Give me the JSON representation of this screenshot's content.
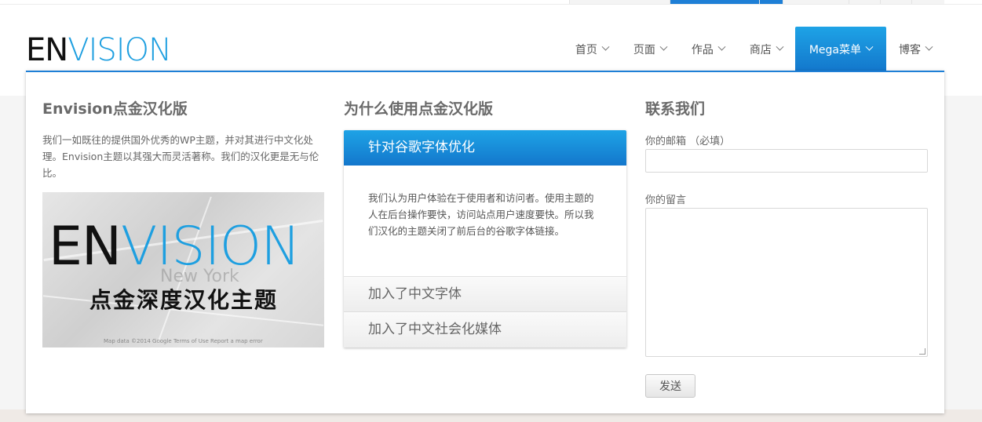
{
  "logo": {
    "part1": "EN",
    "part2": "VISION"
  },
  "nav": {
    "items": [
      {
        "label": "首页"
      },
      {
        "label": "页面"
      },
      {
        "label": "作品"
      },
      {
        "label": "商店"
      },
      {
        "label": "Mega菜单"
      },
      {
        "label": "博客"
      }
    ],
    "active_index": 4
  },
  "mega": {
    "col1": {
      "title": "Envision点金汉化版",
      "text": "我们一如既往的提供国外优秀的WP主题，并对其进行中文化处理。Envision主题以其强大而灵活著称。我们的汉化更是无与伦比。",
      "banner": {
        "part1": "EN",
        "part2": "VISION",
        "subtitle": "点金深度汉化主题",
        "map_label": "New York",
        "credits": "Map data ©2014 Google   Terms of Use   Report a map error"
      }
    },
    "col2": {
      "title": "为什么使用点金汉化版",
      "active_tab": "针对谷歌字体优化",
      "active_body": "我们认为用户体验在于使用者和访问者。使用主题的人在后台操作要快，访问站点用户速度要快。所以我们汉化的主题关闭了前后台的谷歌字体链接。",
      "tabs": [
        "加入了中文字体",
        "加入了中文社会化媒体"
      ]
    },
    "col3": {
      "title": "联系我们",
      "email_label": "你的邮箱 （必填）",
      "email_value": "",
      "message_label": "你的留言",
      "message_value": "",
      "submit_label": "发送"
    }
  },
  "colors": {
    "accent": "#1e7fd6",
    "accent_light": "#1ea3e6"
  }
}
